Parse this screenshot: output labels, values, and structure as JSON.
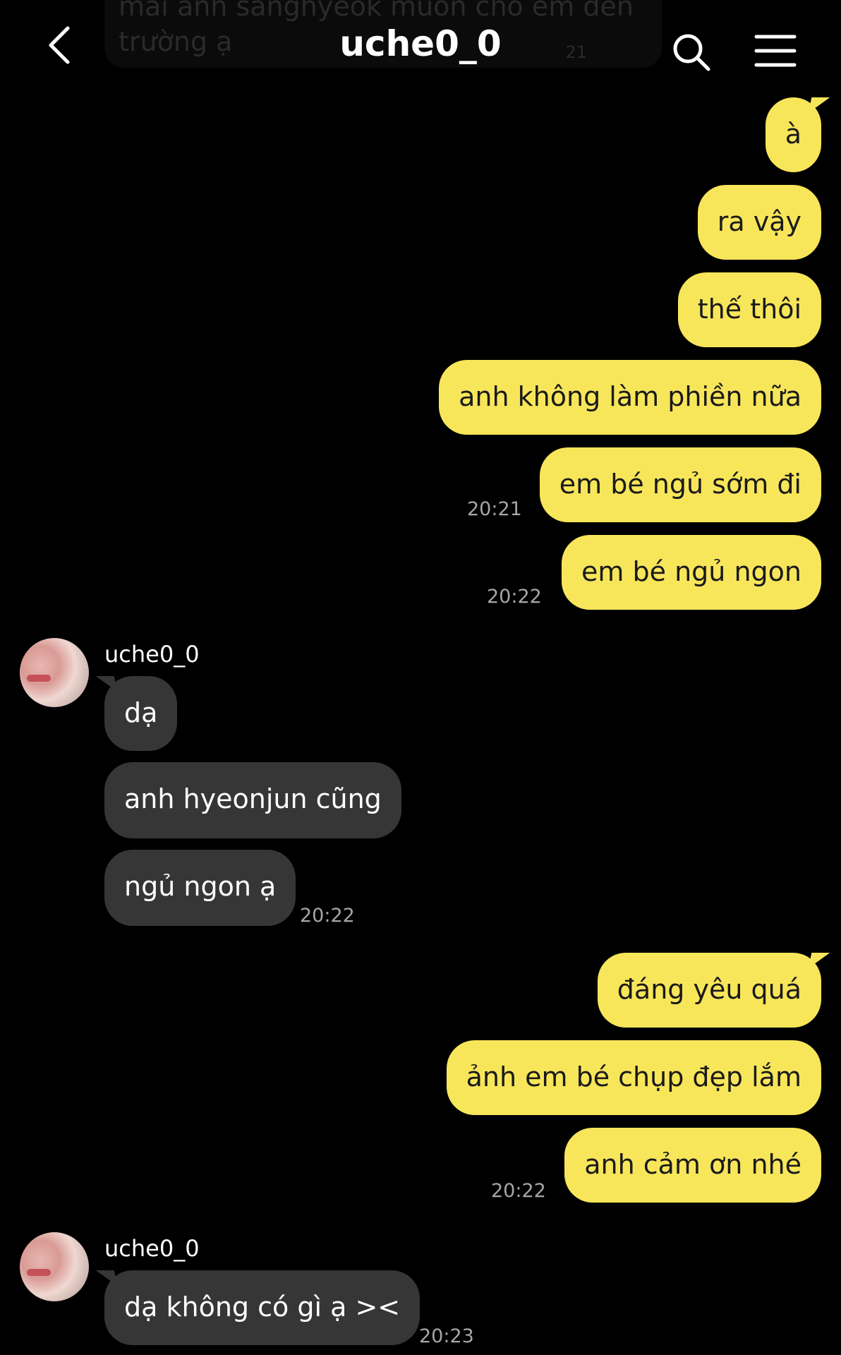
{
  "header": {
    "title": "uche0_0",
    "ghost_text": [
      "mai anh sanghyeok muốn cho em đến",
      "trường ạ"
    ],
    "ghost_time": "21"
  },
  "messages": {
    "m1": "à",
    "m2": "ra vậy",
    "m3": "thế thôi",
    "m4": "anh không làm phiền nữa",
    "m5": "em bé ngủ sớm đi",
    "m6": "em bé ngủ ngon",
    "m7": "dạ",
    "m8": "anh hyeonjun cũng",
    "m9": "ngủ ngon ạ",
    "m10": "đáng yêu quá",
    "m11": "ảnh em bé chụp đẹp lắm",
    "m12": "anh cảm ơn nhé",
    "m13": "dạ không có gì ạ ><"
  },
  "times": {
    "t1": "20:21",
    "t2": "20:22",
    "t3": "20:22",
    "t4": "20:22",
    "t5": "20:23"
  },
  "senders": {
    "s1": "uche0_0",
    "s2": "uche0_0"
  },
  "colors": {
    "background": "#000000",
    "outgoing_bubble": "#f8e65a",
    "incoming_bubble": "#363636",
    "timestamp": "#a6a6a6"
  },
  "icons": [
    "back-arrow-icon",
    "search-icon",
    "menu-icon"
  ]
}
